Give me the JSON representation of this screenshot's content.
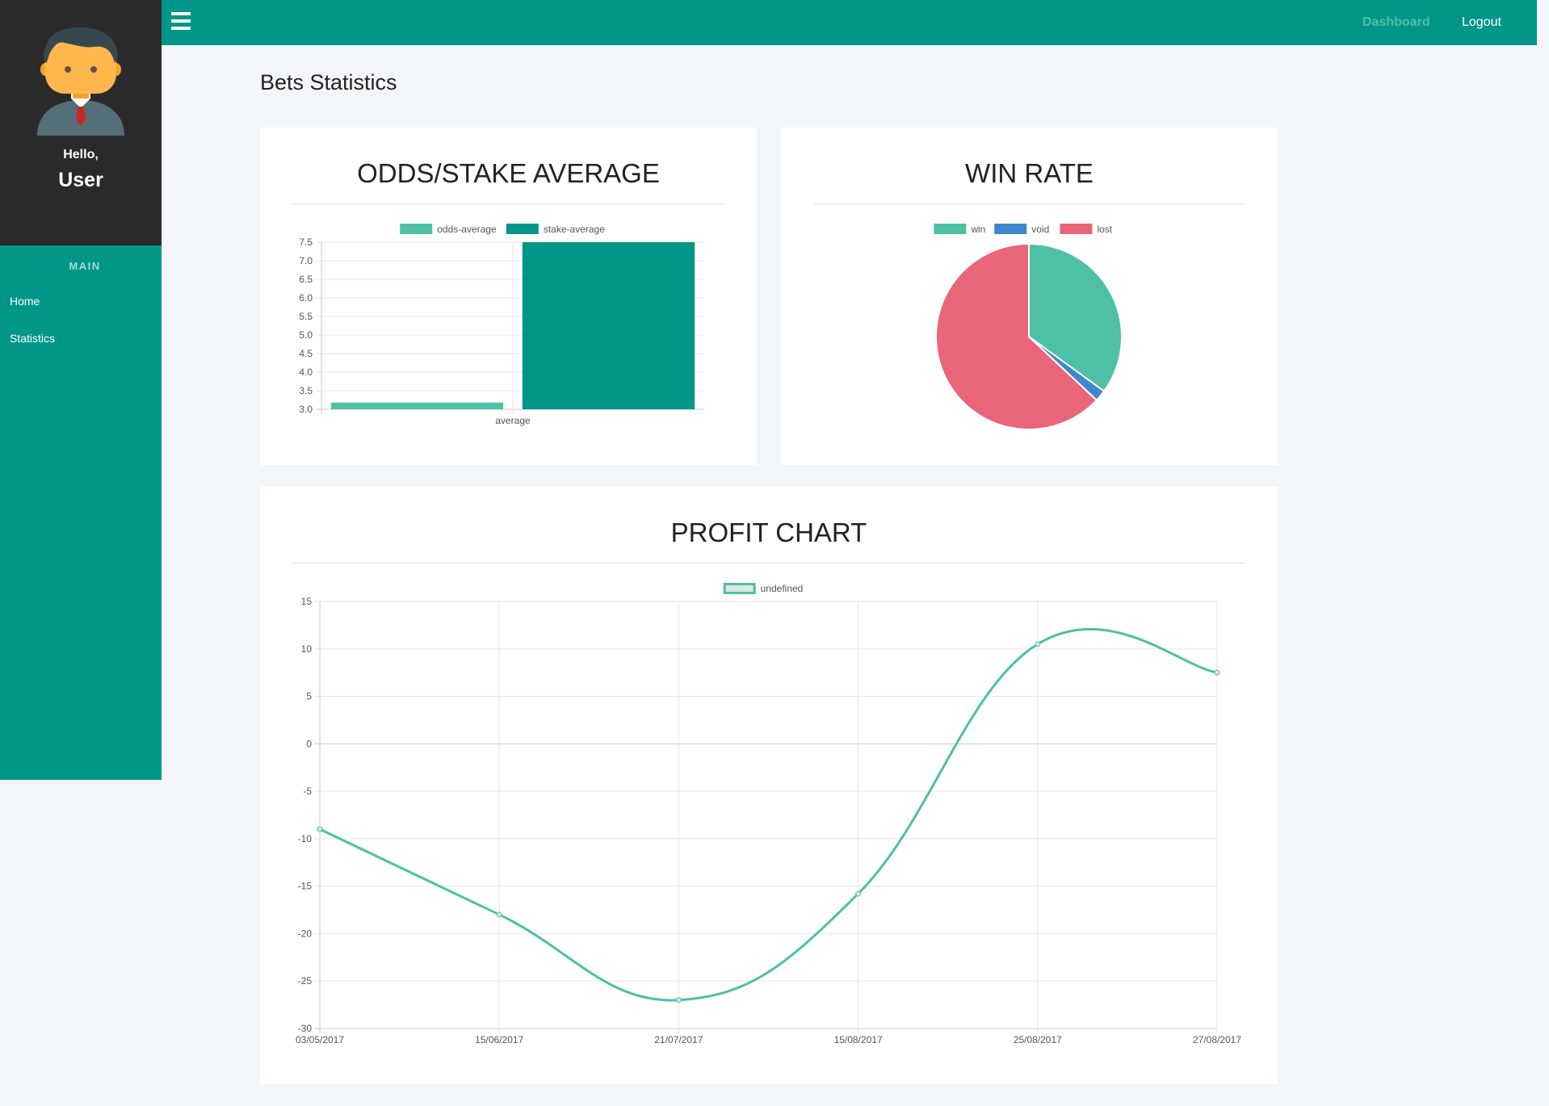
{
  "sidebar": {
    "greeting": "Hello,",
    "username": "User",
    "section": "MAIN",
    "items": [
      {
        "label": "Home"
      },
      {
        "label": "Statistics"
      }
    ]
  },
  "topbar": {
    "dashboard": "Dashboard",
    "logout": "Logout"
  },
  "page": {
    "title": "Bets Statistics"
  },
  "colors": {
    "teal": "#009688",
    "green": "#4dc0a5",
    "blue": "#3e87cc",
    "red": "#e8657a",
    "dark": "#2a2a2a"
  },
  "cards": {
    "odds": {
      "title": "ODDS/STAKE AVERAGE"
    },
    "winrate": {
      "title": "WIN RATE"
    },
    "profit": {
      "title": "PROFIT CHART"
    }
  },
  "chart_data": [
    {
      "type": "bar",
      "title": "ODDS/STAKE AVERAGE",
      "categories": [
        "average"
      ],
      "series": [
        {
          "name": "odds-average",
          "values": [
            3.18
          ],
          "color": "#4dc0a5"
        },
        {
          "name": "stake-average",
          "values": [
            7.5
          ],
          "color": "#009688"
        }
      ],
      "ylim": [
        3.0,
        7.5
      ],
      "yticks": [
        "7.5",
        "7.0",
        "6.5",
        "6.0",
        "5.5",
        "5.0",
        "4.5",
        "4.0",
        "3.5",
        "3.0"
      ],
      "legend": "top",
      "grid": true
    },
    {
      "type": "pie",
      "title": "WIN RATE",
      "labels": [
        "win",
        "void",
        "lost"
      ],
      "values": [
        35,
        2,
        63
      ],
      "colors": [
        "#4dc0a5",
        "#3e87cc",
        "#e8657a"
      ],
      "legend": "top"
    },
    {
      "type": "line",
      "title": "PROFIT CHART",
      "x": [
        "03/05/2017",
        "15/06/2017",
        "21/07/2017",
        "15/08/2017",
        "25/08/2017",
        "27/08/2017"
      ],
      "series": [
        {
          "name": "undefined",
          "values": [
            -9,
            -18,
            -27,
            -15.8,
            10.5,
            7.5
          ],
          "color": "#4dc0a5"
        }
      ],
      "ylim": [
        -30,
        15
      ],
      "yticks": [
        "15",
        "10",
        "5",
        "0",
        "-5",
        "-10",
        "-15",
        "-20",
        "-25",
        "-30"
      ],
      "legend": "top",
      "grid": true
    }
  ]
}
